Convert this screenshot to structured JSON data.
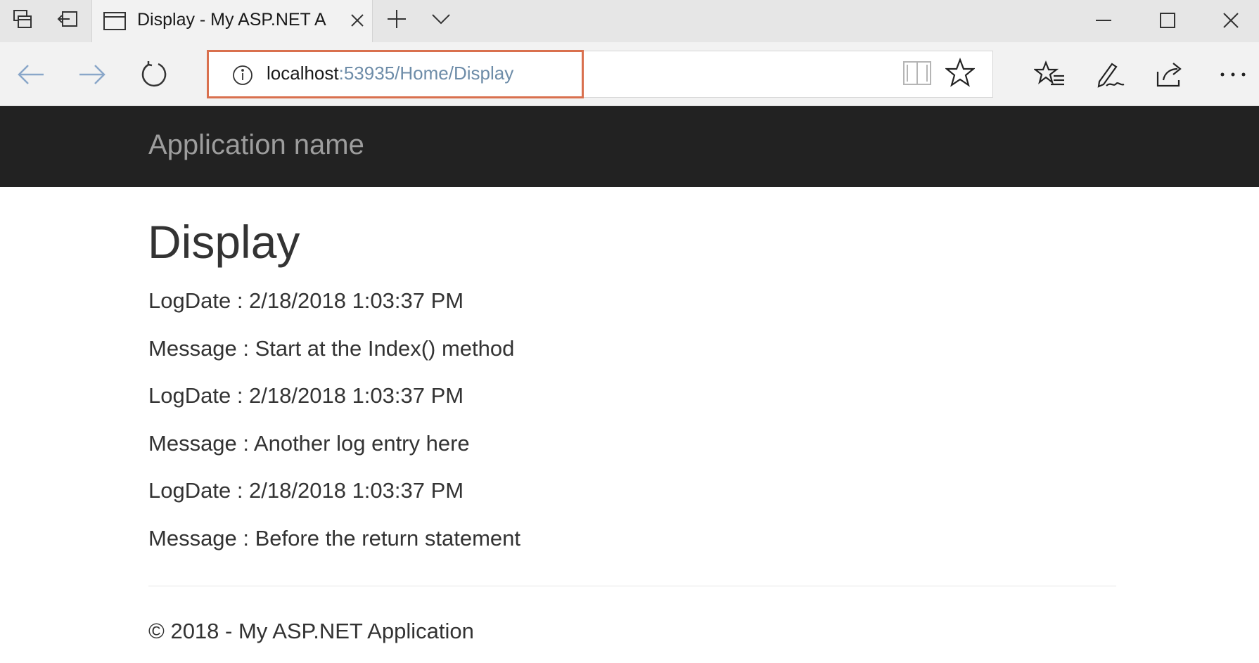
{
  "browser": {
    "tab": {
      "title": "Display - My ASP.NET A"
    },
    "address": {
      "host": "localhost",
      "path": ":53935/Home/Display"
    },
    "icons": {
      "tab_manager": "tabs-aside-icon",
      "back_tab": "set-aside-icon",
      "new_tab": "plus-icon",
      "tab_preview": "chevron-down-icon",
      "back": "arrow-left-icon",
      "forward": "arrow-right-icon",
      "refresh": "refresh-icon",
      "info": "info-icon",
      "reading_view": "book-icon",
      "favorite": "star-icon",
      "favorites_hub": "favorites-list-icon",
      "notes": "pen-icon",
      "share": "share-icon",
      "more": "more-icon"
    }
  },
  "site": {
    "app_name": "Application name",
    "page_title": "Display",
    "entries": [
      "LogDate : 2/18/2018 1:03:37 PM",
      "Message : Start at the Index() method",
      "LogDate : 2/18/2018 1:03:37 PM",
      "Message : Another log entry here",
      "LogDate : 2/18/2018 1:03:37 PM",
      "Message : Before the return statement"
    ],
    "footer": "© 2018 - My ASP.NET Application"
  },
  "colors": {
    "navbar_bg": "#222222",
    "app_name": "#9d9d9d",
    "text": "#333333",
    "url_path": "#6d8ca8",
    "address_focus": "#d9704e"
  }
}
